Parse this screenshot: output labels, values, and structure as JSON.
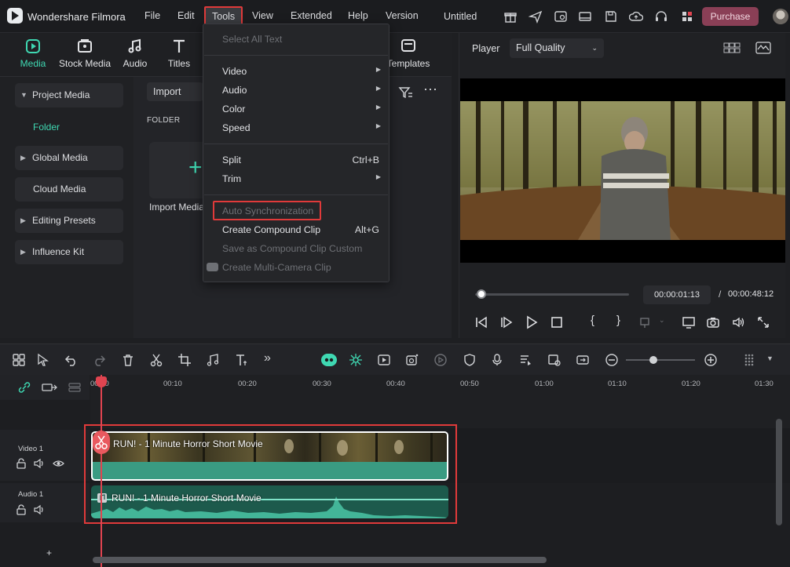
{
  "app": {
    "name": "Wondershare Filmora",
    "project_title": "Untitled",
    "purchase_label": "Purchase"
  },
  "menu": {
    "file": "File",
    "edit": "Edit",
    "tools": "Tools",
    "view": "View",
    "extended": "Extended",
    "help": "Help",
    "version": "Version"
  },
  "tabs": {
    "media": "Media",
    "stock_media": "Stock Media",
    "audio": "Audio",
    "titles": "Titles",
    "templates": "Templates"
  },
  "sidebar": {
    "project_media": "Project Media",
    "folder": "Folder",
    "global_media": "Global Media",
    "cloud_media": "Cloud Media",
    "editing_presets": "Editing Presets",
    "influence_kit": "Influence Kit"
  },
  "media": {
    "import_label": "Import",
    "folder_header": "FOLDER",
    "import_media_label": "Import Media"
  },
  "tools_menu": {
    "select_all_text": "Select All Text",
    "video": "Video",
    "audio": "Audio",
    "color": "Color",
    "speed": "Speed",
    "split": "Split",
    "split_shortcut": "Ctrl+B",
    "trim": "Trim",
    "auto_sync": "Auto Synchronization",
    "create_compound": "Create Compound Clip",
    "create_compound_shortcut": "Alt+G",
    "save_compound": "Save as Compound Clip Custom",
    "multicam": "Create Multi-Camera Clip"
  },
  "player": {
    "label": "Player",
    "quality": "Full Quality",
    "current_time": "00:00:01:13",
    "separator": "/",
    "total_time": "00:00:48:12",
    "progress": 0.03
  },
  "timeline": {
    "ticks": [
      "00:00",
      "00:10",
      "00:20",
      "00:30",
      "00:40",
      "00:50",
      "01:00",
      "01:10",
      "01:20",
      "01:30"
    ],
    "video_track": "Video 1",
    "audio_track": "Audio 1",
    "video_clip_title": "RUN! - 1 Minute Horror Short Movie",
    "audio_clip_title": "RUN! - 1 Minute Horror Short Movie",
    "add_track": "+"
  },
  "colors": {
    "accent": "#3fd8b2",
    "highlight_red": "#e03a3a",
    "purchase_bg": "#8a3f56"
  }
}
